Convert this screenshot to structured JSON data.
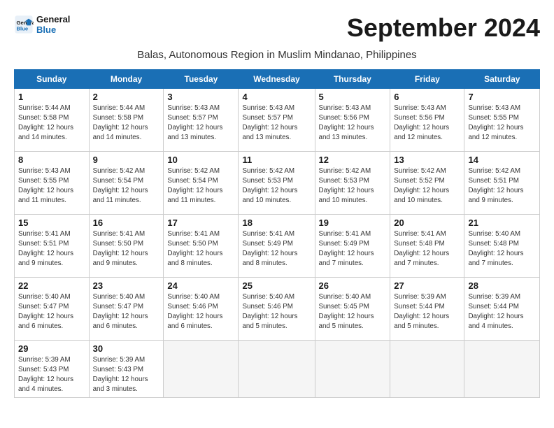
{
  "header": {
    "logo_text_general": "General",
    "logo_text_blue": "Blue",
    "month_title": "September 2024",
    "location": "Balas, Autonomous Region in Muslim Mindanao, Philippines"
  },
  "columns": [
    "Sunday",
    "Monday",
    "Tuesday",
    "Wednesday",
    "Thursday",
    "Friday",
    "Saturday"
  ],
  "weeks": [
    [
      {
        "day": "1",
        "info": "Sunrise: 5:44 AM\nSunset: 5:58 PM\nDaylight: 12 hours\nand 14 minutes."
      },
      {
        "day": "2",
        "info": "Sunrise: 5:44 AM\nSunset: 5:58 PM\nDaylight: 12 hours\nand 14 minutes."
      },
      {
        "day": "3",
        "info": "Sunrise: 5:43 AM\nSunset: 5:57 PM\nDaylight: 12 hours\nand 13 minutes."
      },
      {
        "day": "4",
        "info": "Sunrise: 5:43 AM\nSunset: 5:57 PM\nDaylight: 12 hours\nand 13 minutes."
      },
      {
        "day": "5",
        "info": "Sunrise: 5:43 AM\nSunset: 5:56 PM\nDaylight: 12 hours\nand 13 minutes."
      },
      {
        "day": "6",
        "info": "Sunrise: 5:43 AM\nSunset: 5:56 PM\nDaylight: 12 hours\nand 12 minutes."
      },
      {
        "day": "7",
        "info": "Sunrise: 5:43 AM\nSunset: 5:55 PM\nDaylight: 12 hours\nand 12 minutes."
      }
    ],
    [
      {
        "day": "8",
        "info": "Sunrise: 5:43 AM\nSunset: 5:55 PM\nDaylight: 12 hours\nand 11 minutes."
      },
      {
        "day": "9",
        "info": "Sunrise: 5:42 AM\nSunset: 5:54 PM\nDaylight: 12 hours\nand 11 minutes."
      },
      {
        "day": "10",
        "info": "Sunrise: 5:42 AM\nSunset: 5:54 PM\nDaylight: 12 hours\nand 11 minutes."
      },
      {
        "day": "11",
        "info": "Sunrise: 5:42 AM\nSunset: 5:53 PM\nDaylight: 12 hours\nand 10 minutes."
      },
      {
        "day": "12",
        "info": "Sunrise: 5:42 AM\nSunset: 5:53 PM\nDaylight: 12 hours\nand 10 minutes."
      },
      {
        "day": "13",
        "info": "Sunrise: 5:42 AM\nSunset: 5:52 PM\nDaylight: 12 hours\nand 10 minutes."
      },
      {
        "day": "14",
        "info": "Sunrise: 5:42 AM\nSunset: 5:51 PM\nDaylight: 12 hours\nand 9 minutes."
      }
    ],
    [
      {
        "day": "15",
        "info": "Sunrise: 5:41 AM\nSunset: 5:51 PM\nDaylight: 12 hours\nand 9 minutes."
      },
      {
        "day": "16",
        "info": "Sunrise: 5:41 AM\nSunset: 5:50 PM\nDaylight: 12 hours\nand 9 minutes."
      },
      {
        "day": "17",
        "info": "Sunrise: 5:41 AM\nSunset: 5:50 PM\nDaylight: 12 hours\nand 8 minutes."
      },
      {
        "day": "18",
        "info": "Sunrise: 5:41 AM\nSunset: 5:49 PM\nDaylight: 12 hours\nand 8 minutes."
      },
      {
        "day": "19",
        "info": "Sunrise: 5:41 AM\nSunset: 5:49 PM\nDaylight: 12 hours\nand 7 minutes."
      },
      {
        "day": "20",
        "info": "Sunrise: 5:41 AM\nSunset: 5:48 PM\nDaylight: 12 hours\nand 7 minutes."
      },
      {
        "day": "21",
        "info": "Sunrise: 5:40 AM\nSunset: 5:48 PM\nDaylight: 12 hours\nand 7 minutes."
      }
    ],
    [
      {
        "day": "22",
        "info": "Sunrise: 5:40 AM\nSunset: 5:47 PM\nDaylight: 12 hours\nand 6 minutes."
      },
      {
        "day": "23",
        "info": "Sunrise: 5:40 AM\nSunset: 5:47 PM\nDaylight: 12 hours\nand 6 minutes."
      },
      {
        "day": "24",
        "info": "Sunrise: 5:40 AM\nSunset: 5:46 PM\nDaylight: 12 hours\nand 6 minutes."
      },
      {
        "day": "25",
        "info": "Sunrise: 5:40 AM\nSunset: 5:46 PM\nDaylight: 12 hours\nand 5 minutes."
      },
      {
        "day": "26",
        "info": "Sunrise: 5:40 AM\nSunset: 5:45 PM\nDaylight: 12 hours\nand 5 minutes."
      },
      {
        "day": "27",
        "info": "Sunrise: 5:39 AM\nSunset: 5:44 PM\nDaylight: 12 hours\nand 5 minutes."
      },
      {
        "day": "28",
        "info": "Sunrise: 5:39 AM\nSunset: 5:44 PM\nDaylight: 12 hours\nand 4 minutes."
      }
    ],
    [
      {
        "day": "29",
        "info": "Sunrise: 5:39 AM\nSunset: 5:43 PM\nDaylight: 12 hours\nand 4 minutes."
      },
      {
        "day": "30",
        "info": "Sunrise: 5:39 AM\nSunset: 5:43 PM\nDaylight: 12 hours\nand 3 minutes."
      },
      {
        "day": "",
        "info": ""
      },
      {
        "day": "",
        "info": ""
      },
      {
        "day": "",
        "info": ""
      },
      {
        "day": "",
        "info": ""
      },
      {
        "day": "",
        "info": ""
      }
    ]
  ]
}
